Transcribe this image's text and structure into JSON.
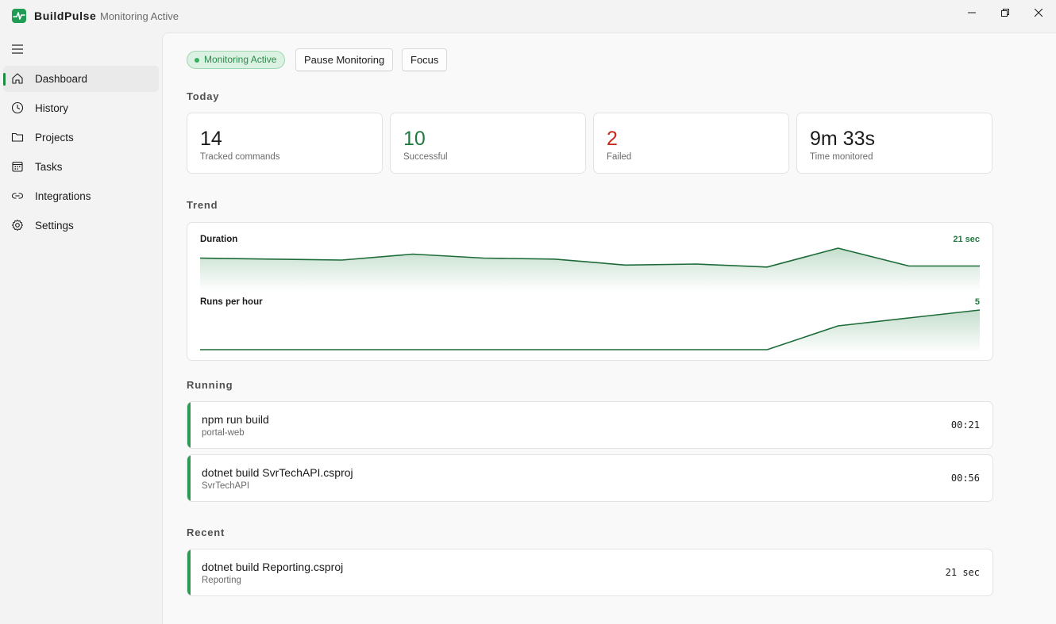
{
  "app": {
    "name": "BuildPulse",
    "status": "Monitoring Active",
    "logo_icon": "pulse-icon",
    "accent": "#1f9d55"
  },
  "window_controls": {
    "minimize": "—",
    "maximize": "❐",
    "close": "✕"
  },
  "sidebar": {
    "items": [
      {
        "label": "Dashboard",
        "icon": "home-icon",
        "active": true
      },
      {
        "label": "History",
        "icon": "clock-icon"
      },
      {
        "label": "Projects",
        "icon": "folder-icon"
      },
      {
        "label": "Tasks",
        "icon": "calendar-icon"
      },
      {
        "label": "Integrations",
        "icon": "link-icon"
      },
      {
        "label": "Settings",
        "icon": "gear-icon"
      }
    ]
  },
  "toolbar": {
    "status_badge": "Monitoring Active",
    "pause_label": "Pause Monitoring",
    "focus_label": "Focus"
  },
  "today": {
    "title": "Today",
    "stats": [
      {
        "value": "14",
        "label": "Tracked commands"
      },
      {
        "value": "10",
        "label": "Successful"
      },
      {
        "value": "2",
        "label": "Failed"
      },
      {
        "value": "9m 33s",
        "label": "Time monitored"
      }
    ]
  },
  "trend": {
    "title": "Trend",
    "duration": {
      "label": "Duration",
      "value": "21 sec",
      "points": [
        30,
        29,
        28,
        34,
        30,
        29,
        23,
        24,
        21,
        40,
        22,
        22
      ]
    },
    "runs": {
      "label": "Runs per hour",
      "value": "5",
      "points": [
        0,
        0,
        0,
        0,
        0,
        0,
        0,
        0,
        0,
        3,
        4,
        5
      ]
    }
  },
  "running": {
    "title": "Running",
    "items": [
      {
        "command": "npm run build",
        "project": "portal-web",
        "elapsed": "00:21"
      },
      {
        "command": "dotnet build SvrTechAPI.csproj",
        "project": "SvrTechAPI",
        "elapsed": "00:56"
      }
    ]
  },
  "recent": {
    "title": "Recent",
    "items": [
      {
        "command": "dotnet build Reporting.csproj",
        "project": "Reporting",
        "duration": "21 sec"
      }
    ]
  }
}
